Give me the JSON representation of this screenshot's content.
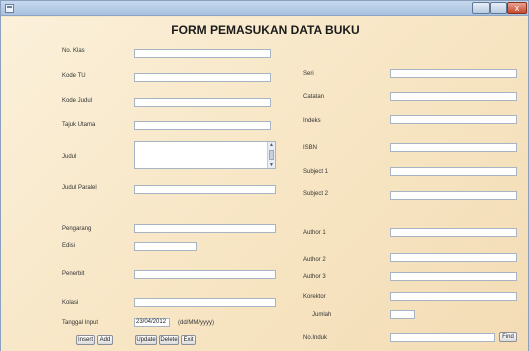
{
  "window": {
    "title_bar": {
      "minimize": "",
      "maximize": "",
      "close": "x"
    }
  },
  "form": {
    "title": "FORM PEMASUKAN DATA BUKU",
    "left_labels": {
      "no_klas": "No. Klas",
      "kode_tu": "Kode TU",
      "kode_judul": "Kode Judul",
      "tajuk_utama": "Tajuk Utama",
      "judul": "Judul",
      "judul_paralel": "Judul Paralel",
      "pengarang": "Pengarang",
      "edisi": "Edisi",
      "penerbit": "Penerbit",
      "kolasi": "Kolasi",
      "tanggal_input": "Tanggal Input"
    },
    "right_labels": {
      "seri": "Seri",
      "catatan": "Catatan",
      "indeks": "Indeks",
      "isbn": "ISBN",
      "subject_1": "Subject 1",
      "subject_2": "Subject 2",
      "author_1": "Author 1",
      "author_2": "Author 2",
      "author_3": "Author 3",
      "korektor": "Korektor",
      "jumlah": "Jumlah",
      "no_induk": "No.Induk"
    },
    "tanggal_input_value": "23/04/2012",
    "date_format_hint": "(dd/MM/yyyy)",
    "buttons": {
      "insert": "Insert",
      "add": "Add",
      "update": "Update",
      "delete": "Delete",
      "exit": "Exit",
      "find": "Find"
    }
  }
}
